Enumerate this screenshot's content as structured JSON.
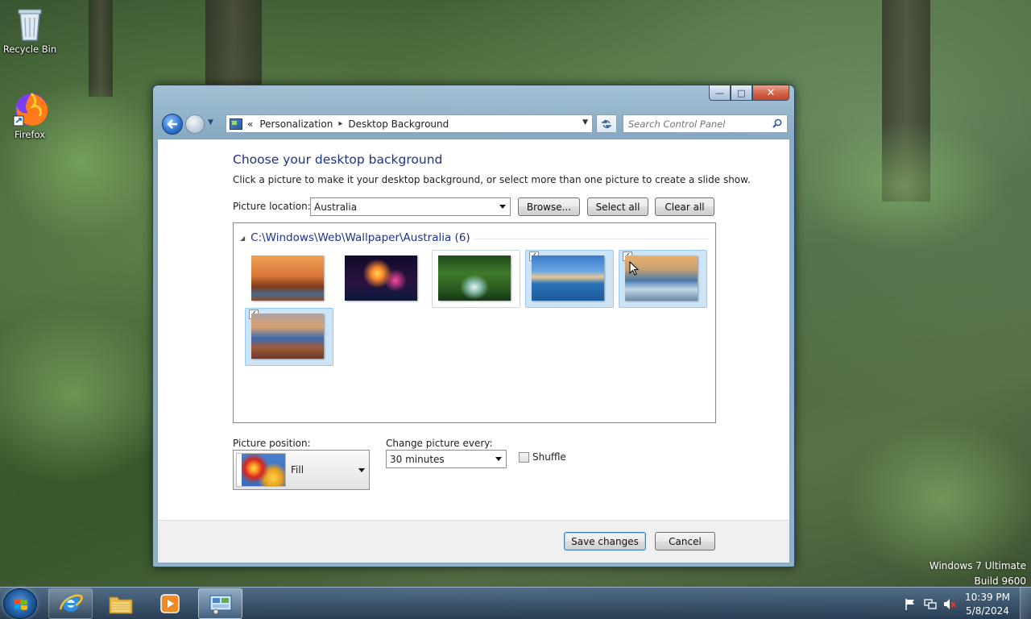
{
  "desktop": {
    "icons": [
      {
        "label": "Recycle Bin",
        "icon": "recycle-bin-icon"
      },
      {
        "label": "Firefox",
        "icon": "firefox-icon"
      }
    ],
    "watermark": {
      "line1": "Windows 7 Ultimate",
      "line2": "Build 9600"
    }
  },
  "window": {
    "caption": {
      "minimize": "—",
      "maximize": "□",
      "close": "✕"
    },
    "address": {
      "crumb_prefix": "«",
      "crumbs": [
        "Personalization",
        "Desktop Background"
      ],
      "separator": "▸"
    },
    "search_placeholder": "Search Control Panel"
  },
  "content": {
    "heading": "Choose your desktop background",
    "description": "Click a picture to make it your desktop background, or select more than one picture to create a slide show.",
    "picture_location_label": "Picture location:",
    "picture_location_value": "Australia",
    "browse_label": "Browse...",
    "select_all_label": "Select all",
    "clear_all_label": "Clear all",
    "group_title": "C:\\Windows\\Web\\Wallpaper\\Australia (6)",
    "thumbnails": [
      {
        "subject": "baobab trees at sunset",
        "checked": false,
        "state": "normal"
      },
      {
        "subject": "fireworks over harbour",
        "checked": false,
        "state": "normal"
      },
      {
        "subject": "rainforest waterfall",
        "checked": false,
        "state": "hover"
      },
      {
        "subject": "sydney harbour aerial",
        "checked": true,
        "state": "selected"
      },
      {
        "subject": "coastal rock stacks",
        "checked": true,
        "state": "selected"
      },
      {
        "subject": "outback river rocks",
        "checked": true,
        "state": "selected"
      }
    ],
    "check_mark": "✓",
    "picture_position_label": "Picture position:",
    "picture_position_value": "Fill",
    "change_every_label": "Change picture every:",
    "change_every_value": "30 minutes",
    "shuffle_label": "Shuffle",
    "shuffle_checked": false,
    "save_label": "Save changes",
    "cancel_label": "Cancel"
  },
  "taskbar": {
    "pinned": [
      "internet-explorer-icon",
      "file-explorer-icon",
      "media-player-icon",
      "control-panel-icon"
    ],
    "active": "control-panel-icon",
    "clock_time": "10:39 PM",
    "clock_date": "5/8/2024"
  }
}
